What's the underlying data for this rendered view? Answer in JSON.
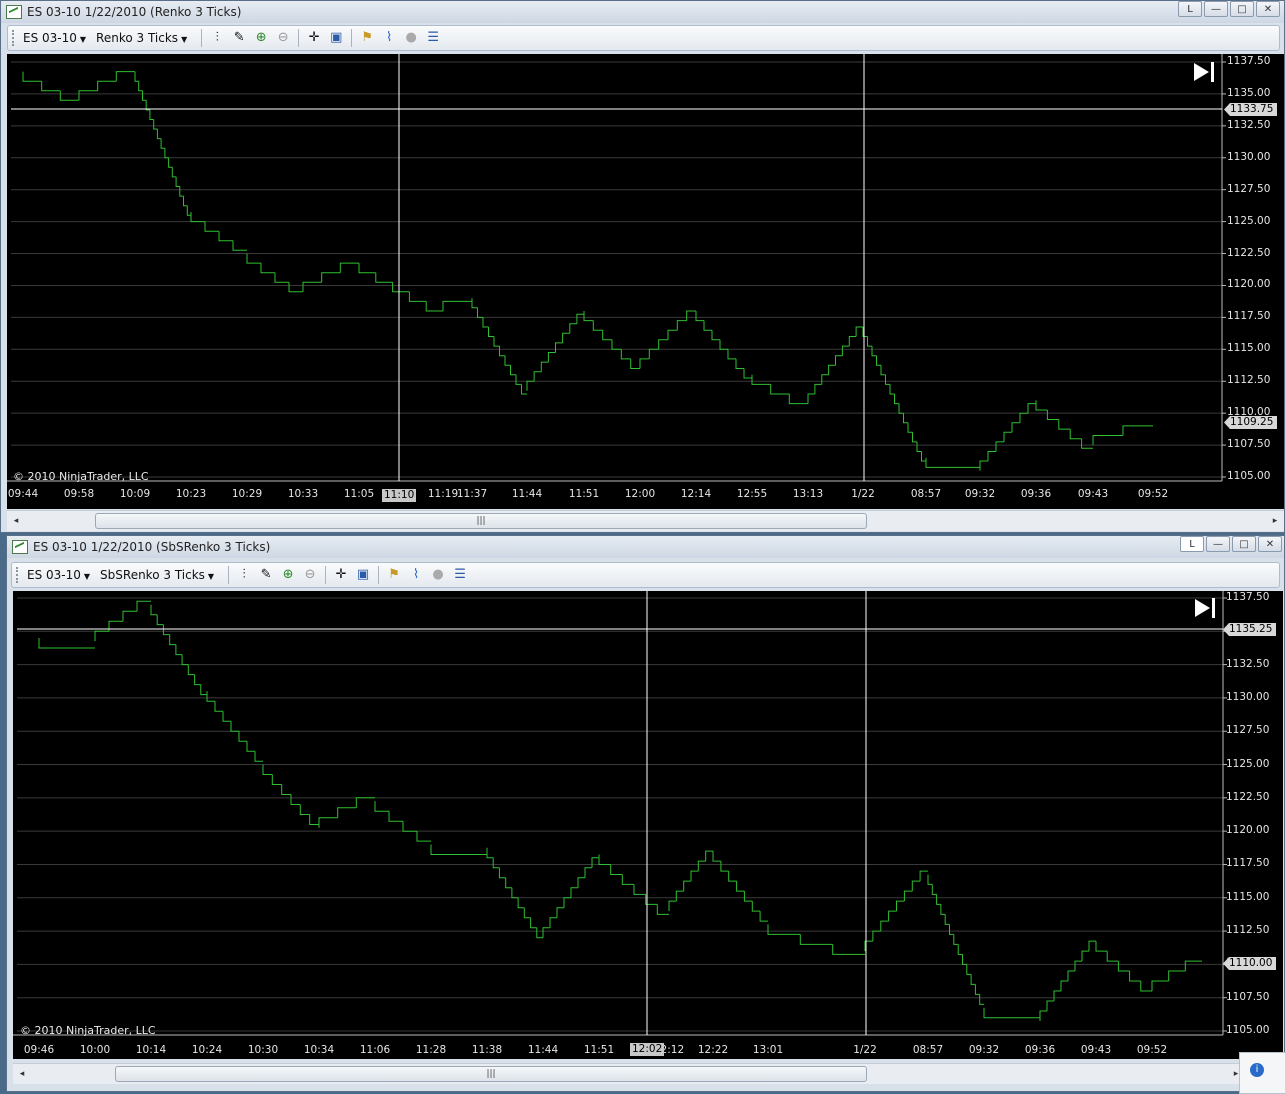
{
  "windows": [
    {
      "title": "ES 03-10  1/22/2010 (Renko 3 Ticks)",
      "controls": {
        "pin": "L",
        "minimize": "—",
        "maximize": "□",
        "close": "✕"
      },
      "toolbar": {
        "instrument": "ES 03-10",
        "bar_type": "Renko 3 Ticks"
      },
      "copyright": "© 2010 NinjaTrader, LLC",
      "price_labels": [
        "1137.50",
        "1135.00",
        "1132.50",
        "1130.00",
        "1127.50",
        "1125.00",
        "1122.50",
        "1120.00",
        "1117.50",
        "1115.00",
        "1112.50",
        "1110.00",
        "1107.50",
        "1105.00"
      ],
      "time_labels": [
        "09:44",
        "09:58",
        "10:09",
        "10:23",
        "10:29",
        "10:33",
        "11:05",
        "11:10",
        "11:19",
        "11:37",
        "11:44",
        "11:51",
        "12:00",
        "12:14",
        "12:55",
        "13:13",
        "1/22",
        "08:57",
        "09:32",
        "09:36",
        "09:43",
        "09:52"
      ],
      "crosshair_price": "1133.75",
      "crosshair_time": "11:10",
      "last_price": "1109.25"
    },
    {
      "title": "ES 03-10  1/22/2010 (SbSRenko 3 Ticks)",
      "controls": {
        "pin": "L",
        "minimize": "—",
        "maximize": "□",
        "close": "✕"
      },
      "toolbar": {
        "instrument": "ES 03-10",
        "bar_type": "SbSRenko 3 Ticks"
      },
      "copyright": "© 2010 NinjaTrader, LLC",
      "price_labels": [
        "1137.50",
        "1135.00",
        "1132.50",
        "1130.00",
        "1127.50",
        "1125.00",
        "1122.50",
        "1120.00",
        "1117.50",
        "1115.00",
        "1112.50",
        "1110.00",
        "1107.50",
        "1105.00"
      ],
      "time_labels": [
        "09:46",
        "10:00",
        "10:14",
        "10:24",
        "10:30",
        "10:34",
        "11:06",
        "11:28",
        "11:38",
        "11:44",
        "11:51",
        "12:02",
        "12:12",
        "12:22",
        "13:01",
        "1/22",
        "08:57",
        "09:32",
        "09:36",
        "09:43",
        "09:52"
      ],
      "crosshair_price": "1135.25",
      "crosshair_time": "12:02",
      "last_price": "1110.00"
    }
  ],
  "colors": {
    "bars": "#2fbf2f",
    "background": "#000000",
    "grid": "#3a3a3a",
    "crosshair": "#ffffff"
  },
  "chart_data": [
    {
      "type": "line",
      "title": "ES 03-10 1/22/2010 (Renko 3 Ticks)",
      "ylim": [
        1105.0,
        1137.5
      ],
      "x": [
        "09:44",
        "09:58",
        "10:09",
        "10:23",
        "10:29",
        "10:33",
        "11:05",
        "11:19",
        "11:37",
        "11:44",
        "11:51",
        "12:00",
        "12:14",
        "12:55",
        "13:13",
        "1/22",
        "08:57",
        "09:32",
        "09:36",
        "09:43",
        "09:52"
      ],
      "series": [
        {
          "values": [
            1136.75,
            1134.5,
            1136.75,
            1125.75,
            1122.5,
            1119.5,
            1121.75,
            1118.0,
            1119.0,
            1111.75,
            1118.0,
            1113.5,
            1118.0,
            1113.0,
            1110.75,
            1116.75,
            1106.5,
            1105.5,
            1111.0,
            1107.5,
            1109.25
          ]
        }
      ]
    },
    {
      "type": "line",
      "title": "ES 03-10 1/22/2010 (SbSRenko 3 Ticks)",
      "ylim": [
        1105.0,
        1137.5
      ],
      "x": [
        "09:46",
        "10:00",
        "10:14",
        "10:24",
        "10:30",
        "10:34",
        "11:06",
        "11:28",
        "11:38",
        "11:44",
        "11:51",
        "12:02",
        "12:12",
        "12:22",
        "13:01",
        "1/22",
        "08:57",
        "09:32",
        "09:36",
        "09:43",
        "09:52"
      ],
      "series": [
        {
          "values": [
            1134.5,
            1134.25,
            1137.0,
            1130.5,
            1125.0,
            1120.25,
            1122.25,
            1119.0,
            1118.75,
            1112.0,
            1118.25,
            1114.0,
            1118.5,
            1113.0,
            1111.0,
            1116.75,
            1106.75,
            1105.75,
            1111.75,
            1108.0,
            1110.0
          ]
        }
      ]
    }
  ]
}
